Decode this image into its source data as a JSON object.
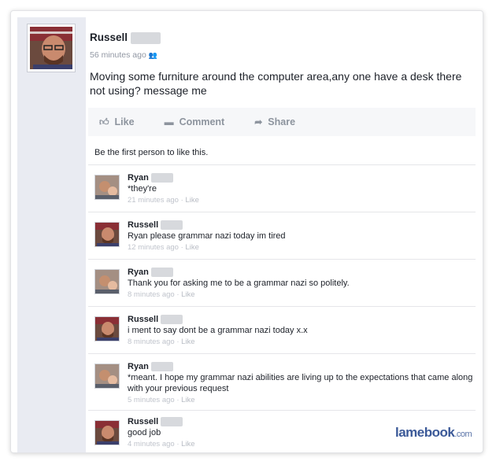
{
  "post": {
    "author": "Russell",
    "time": "56 minutes ago",
    "audience_icon": "friends-icon",
    "text": "Moving some furniture around the computer area,any one have a desk there not using? message me"
  },
  "actions": {
    "like": "Like",
    "comment": "Comment",
    "share": "Share"
  },
  "first_like": "Be the first person to like this.",
  "comments": [
    {
      "name": "Ryan",
      "text": "*they're",
      "time": "21 minutes ago",
      "like": "Like"
    },
    {
      "name": "Russell",
      "text": "Ryan please grammar nazi today im tired",
      "time": "12 minutes ago",
      "like": "Like"
    },
    {
      "name": "Ryan",
      "text": "Thank you for asking me to be a grammar nazi so politely.",
      "time": "8 minutes ago",
      "like": "Like"
    },
    {
      "name": "Russell",
      "text": "i ment to say dont be a grammar nazi today x.x",
      "time": "8 minutes ago",
      "like": "Like"
    },
    {
      "name": "Ryan",
      "text": "*meant. I hope my grammar nazi abilities are living up to the expectations that came along with your previous request",
      "time": "5 minutes ago",
      "like": "Like"
    },
    {
      "name": "Russell",
      "text": "good job",
      "time": "4 minutes ago",
      "like": "Like"
    }
  ],
  "watermark": {
    "brand": "lamebook",
    "domain": ".com"
  },
  "colors": {
    "brand": "#3b5998",
    "rail": "#e9ebf2",
    "muted": "#9197a3"
  }
}
